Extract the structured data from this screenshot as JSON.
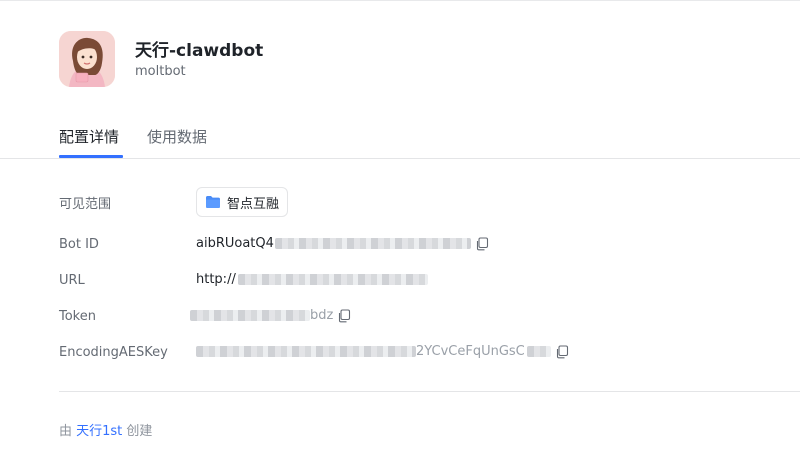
{
  "bot": {
    "name": "天行-clawdbot",
    "subtitle": "moltbot"
  },
  "tabs": [
    {
      "label": "配置详情",
      "active": true
    },
    {
      "label": "使用数据",
      "active": false
    }
  ],
  "details": {
    "scope": {
      "label": "可见范围",
      "value": "智点互融",
      "icon": "folder-icon"
    },
    "bot_id": {
      "label": "Bot ID",
      "visible_value": "aibRUoatQ4",
      "masked": true
    },
    "url": {
      "label": "URL",
      "visible_value": "http://",
      "masked": true
    },
    "token": {
      "label": "Token",
      "visible_tail": "bdz",
      "masked": true
    },
    "encoding_aes_key": {
      "label": "EncodingAESKey",
      "visible_tail": "2YCvCeFqUnGsC",
      "masked": true
    }
  },
  "footer": {
    "prefix": "由 ",
    "creator": "天行1st",
    "suffix": " 创建"
  },
  "colors": {
    "accent": "#3370ff",
    "text_primary": "#1f2329",
    "text_secondary": "#646a73",
    "divider": "#e4e5e7"
  }
}
